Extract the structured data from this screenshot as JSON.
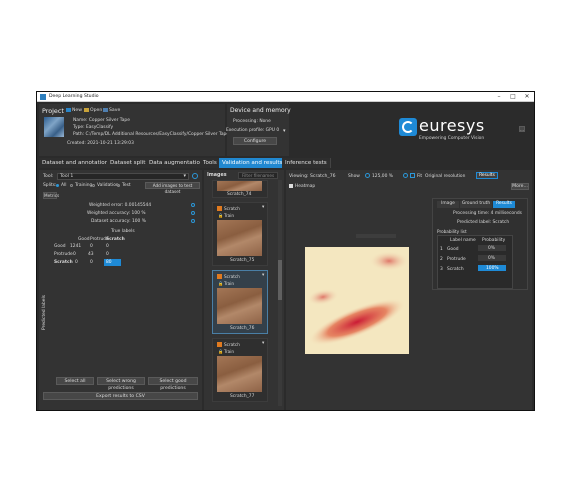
{
  "window": {
    "title": "Deep Learning Studio"
  },
  "project": {
    "heading": "Project",
    "new_label": "New",
    "open_label": "Open",
    "save_label": "Save",
    "name": "Name: Copper Silver Tape",
    "type": "Type: EasyClassify",
    "path": "Path: C:/Temp/DL Additional Resources/EasyClassify/Copper Silver Tape",
    "created": "Created: 2021-10-21 13:29:03"
  },
  "device": {
    "heading": "Device and memory",
    "processing": "Processing: None",
    "profile": "Execution profile: GPU 0",
    "configure_label": "Configure"
  },
  "brand": {
    "name": "euresys",
    "tagline": "Empowering Computer Vision",
    "accent": "#1e8ad6"
  },
  "tabs": [
    {
      "label": "Dataset and annotations"
    },
    {
      "label": "Dataset split"
    },
    {
      "label": "Data augmentation"
    },
    {
      "label": "Tools"
    },
    {
      "label": "Validation and results"
    },
    {
      "label": "Inference tests"
    }
  ],
  "left": {
    "tool_label": "Tool:",
    "tool_value": "Tool 1",
    "splits_label": "Splits:",
    "split_all": "All",
    "split_training": "Training",
    "split_validation": "Validation",
    "split_test": "Test",
    "add_images": "Add images to test dataset",
    "metrics_tab": "Metrics",
    "weighted_error": "Weighted error: 0.00145544",
    "weighted_accuracy": "Weighted accuracy: 100 %",
    "dataset_accuracy": "Dataset accuracy: 100 %",
    "true_labels": "True labels",
    "predicted_labels": "Predicted labels",
    "matrix": {
      "headers": [
        "Good",
        "Protrude",
        "Scratch"
      ],
      "rows": [
        {
          "label": "Good",
          "values": [
            "1241",
            "0",
            "0"
          ]
        },
        {
          "label": "Protrude",
          "values": [
            "0",
            "43",
            "0"
          ]
        },
        {
          "label": "Scratch",
          "values": [
            "0",
            "0",
            "80"
          ]
        }
      ]
    },
    "select_all": "Select all",
    "select_wrong": "Select wrong predictions",
    "select_good": "Select good predictions",
    "export_csv": "Export results to CSV"
  },
  "images": {
    "heading": "Images",
    "filter_label": "Filter filenames",
    "items": [
      {
        "caption": "Scratch_74",
        "label": "Scratch",
        "split": "Train",
        "partial": "top"
      },
      {
        "caption": "Scratch_75",
        "label": "Scratch",
        "split": "Train"
      },
      {
        "caption": "Scratch_76",
        "label": "Scratch",
        "split": "Train"
      },
      {
        "caption": "Scratch_77",
        "label": "Scratch",
        "split": "Train"
      }
    ]
  },
  "viewer": {
    "viewing": "Viewing: Scratch_76",
    "show_label": "Show",
    "zoom": "125,00 %",
    "fit": "Fit",
    "original": "Original resolution",
    "results_button": "Results",
    "heatmap_label": "Heatmap",
    "more_label": "More..."
  },
  "results_panel": {
    "tabs": [
      "Image",
      "Ground truth",
      "Results"
    ],
    "processing_time": "Processing time: 4 milliseconds",
    "predicted_label": "Predicted label: Scratch",
    "prob_list": "Probability list",
    "col_label": "Label name",
    "col_prob": "Probability",
    "rows": [
      {
        "idx": "1",
        "name": "Good",
        "prob": "0%"
      },
      {
        "idx": "2",
        "name": "Protrude",
        "prob": "0%"
      },
      {
        "idx": "3",
        "name": "Scratch",
        "prob": "100%"
      }
    ]
  }
}
